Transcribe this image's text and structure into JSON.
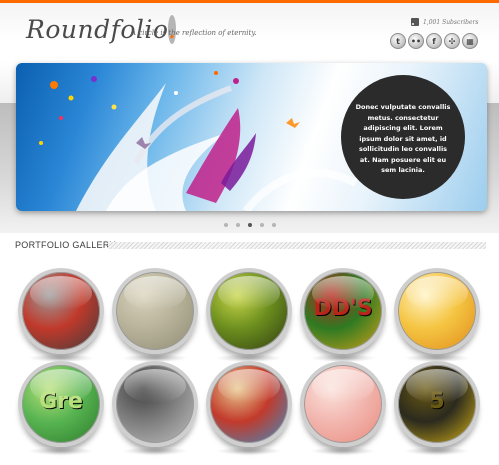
{
  "brand": {
    "logo_text": "Roundfolio",
    "logo_dot": ".",
    "tagline": "A circle is the reflection of eternity.",
    "accent_color": "#ff6a00"
  },
  "header": {
    "subscribers": "1,001 Subscribers",
    "social": [
      {
        "icon": "twitter-icon",
        "glyph": "t"
      },
      {
        "icon": "flickr-icon",
        "glyph": "••"
      },
      {
        "icon": "facebook-icon",
        "glyph": "f"
      },
      {
        "icon": "dribbble-icon",
        "glyph": "✣"
      },
      {
        "icon": "delicious-icon",
        "glyph": "▦"
      }
    ]
  },
  "slider": {
    "caption": "Donec vulputate convallis metus. consectetur adipiscing elit. Lorem ipsum dolor sit amet, id sollicitudin leo convallis at. Nam posuere elit eu sem lacinia.",
    "slide_count": 5,
    "active_slide": 3
  },
  "portfolio": {
    "title": "PORTFOLIO GALLERY",
    "items": [
      {
        "name": "portfolio-thumb-1",
        "colors": [
          "#c0392b",
          "#3d3d3d",
          "#9a9a9a"
        ],
        "word": ""
      },
      {
        "name": "portfolio-thumb-2",
        "colors": [
          "#b8b39a",
          "#8f8a73",
          "#d9d2bb"
        ],
        "word": ""
      },
      {
        "name": "portfolio-thumb-3",
        "colors": [
          "#6c8f1e",
          "#2f3b12",
          "#c9d64a"
        ],
        "word": ""
      },
      {
        "name": "portfolio-thumb-4",
        "colors": [
          "#2f7a23",
          "#d6a218",
          "#b8261b"
        ],
        "word": "DD'S"
      },
      {
        "name": "portfolio-thumb-5",
        "colors": [
          "#f5c542",
          "#e08a1a",
          "#fff3c4"
        ],
        "word": ""
      },
      {
        "name": "portfolio-thumb-6",
        "colors": [
          "#58b552",
          "#2c7a2a",
          "#b8e07a"
        ],
        "word": "Gre"
      },
      {
        "name": "portfolio-thumb-7",
        "colors": [
          "#7d7d7d",
          "#c2c2c2",
          "#3f3f3f"
        ],
        "word": ""
      },
      {
        "name": "portfolio-thumb-8",
        "colors": [
          "#c23a2b",
          "#3a8fc7",
          "#e8c98f"
        ],
        "word": ""
      },
      {
        "name": "portfolio-thumb-9",
        "colors": [
          "#f2b7b0",
          "#e98a7d",
          "#fbe3dc"
        ],
        "word": ""
      },
      {
        "name": "portfolio-thumb-10",
        "colors": [
          "#2b2a1e",
          "#d9b515",
          "#6b5a12"
        ],
        "word": "5"
      }
    ]
  }
}
